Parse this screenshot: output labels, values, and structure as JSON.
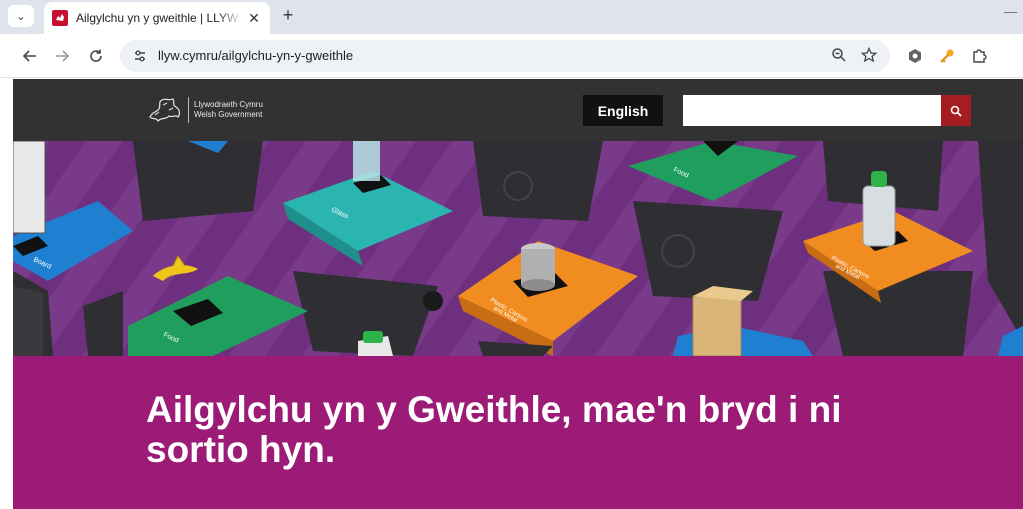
{
  "browser": {
    "tab": {
      "title": "Ailgylchu yn y gweithle | LLYW.CYMRU",
      "close_glyph": "✕"
    },
    "new_tab_glyph": "+",
    "address": {
      "url": "llyw.cymru/ailgylchu-yn-y-gweithle"
    },
    "icons": {
      "tab_menu": "chevron-down-icon",
      "back": "back-arrow-icon",
      "forward": "forward-arrow-icon",
      "reload": "reload-icon",
      "site_info": "tune-icon",
      "zoom": "zoom-icon",
      "bookmark": "star-icon",
      "extensions": [
        "extension-hex-icon",
        "key-icon",
        "puzzle-icon"
      ]
    }
  },
  "site": {
    "logo": {
      "line1": "Llywodraeth Cymru",
      "line2": "Welsh Government"
    },
    "language_button": "English",
    "search": {
      "placeholder": "",
      "value": ""
    }
  },
  "hero": {
    "bin_labels": [
      "Glass",
      "Food",
      "Food",
      "Plastic, Cartons and Metal",
      "Plastic, Cartons and Metal",
      "Board"
    ]
  },
  "banner": {
    "heading": "Ailgylchu yn y Gweithle, mae'n bryd i ni sortio hyn."
  },
  "colors": {
    "header_bg": "#323232",
    "banner_bg": "#9b1b76",
    "search_button": "#a51d20",
    "hero_bg": "#6e2f7e",
    "bin_teal": "#2bb5b0",
    "bin_green": "#1f9e5e",
    "bin_orange": "#f08c20",
    "bin_blue": "#1f7fd0"
  }
}
